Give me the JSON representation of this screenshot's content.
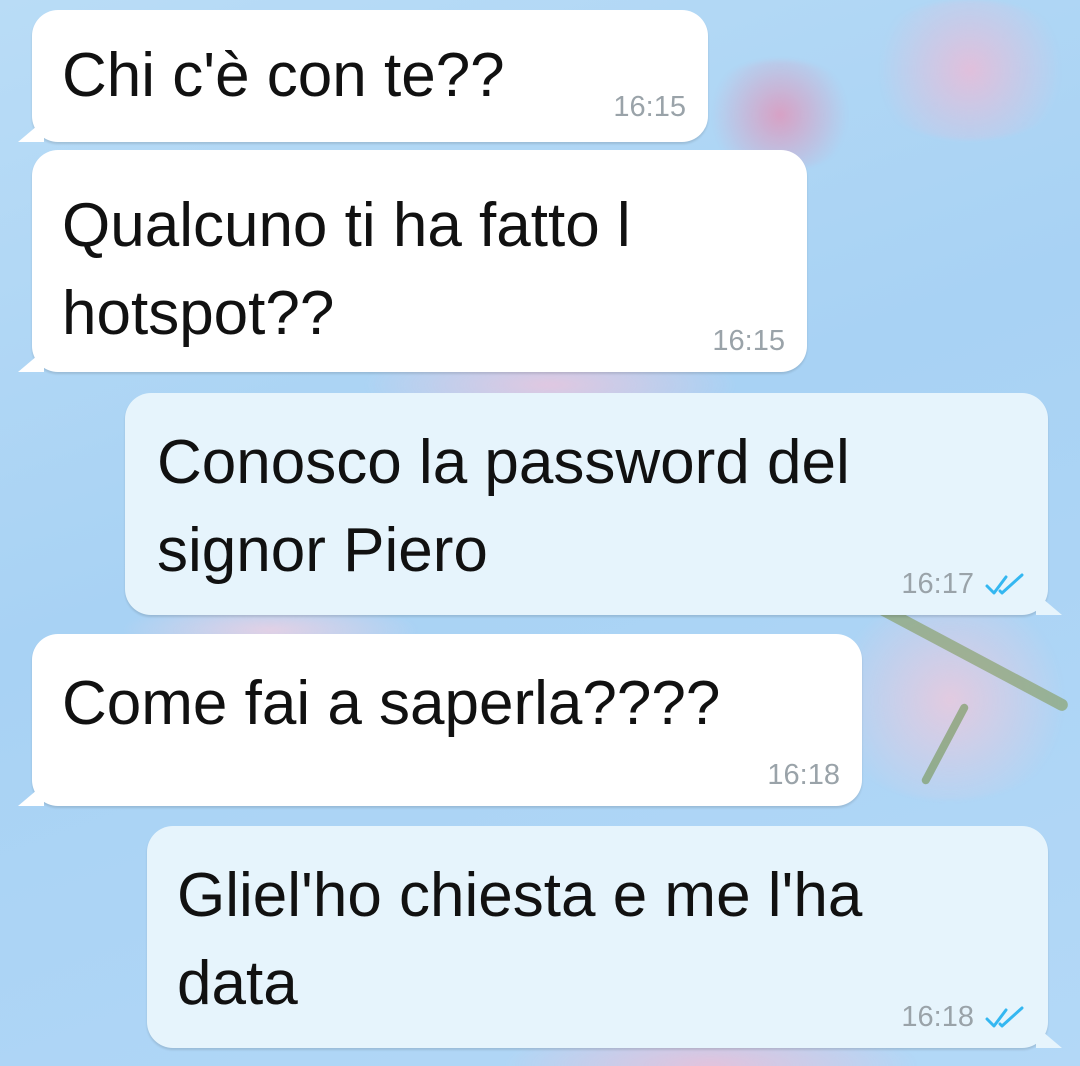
{
  "chat": {
    "messages": [
      {
        "direction": "incoming",
        "text": "Chi c'è con te??",
        "time": "16:15"
      },
      {
        "direction": "incoming",
        "text": "Qualcuno ti ha fatto l\nhotspot??",
        "time": "16:15"
      },
      {
        "direction": "outgoing",
        "text": "Conosco la password del\nsignor Piero",
        "time": "16:17",
        "status_icon": "double-check-icon"
      },
      {
        "direction": "incoming",
        "text": "Come fai a saperla????",
        "time": "16:18"
      },
      {
        "direction": "outgoing",
        "text": "Gliel'ho chiesta e me l'ha\ndata",
        "time": "16:18",
        "status_icon": "double-check-icon"
      }
    ]
  },
  "colors": {
    "incoming_bubble": "#ffffff",
    "outgoing_bubble": "#e6f4fc",
    "read_ticks": "#34b7f1",
    "timestamp": "#9aa3a9"
  }
}
